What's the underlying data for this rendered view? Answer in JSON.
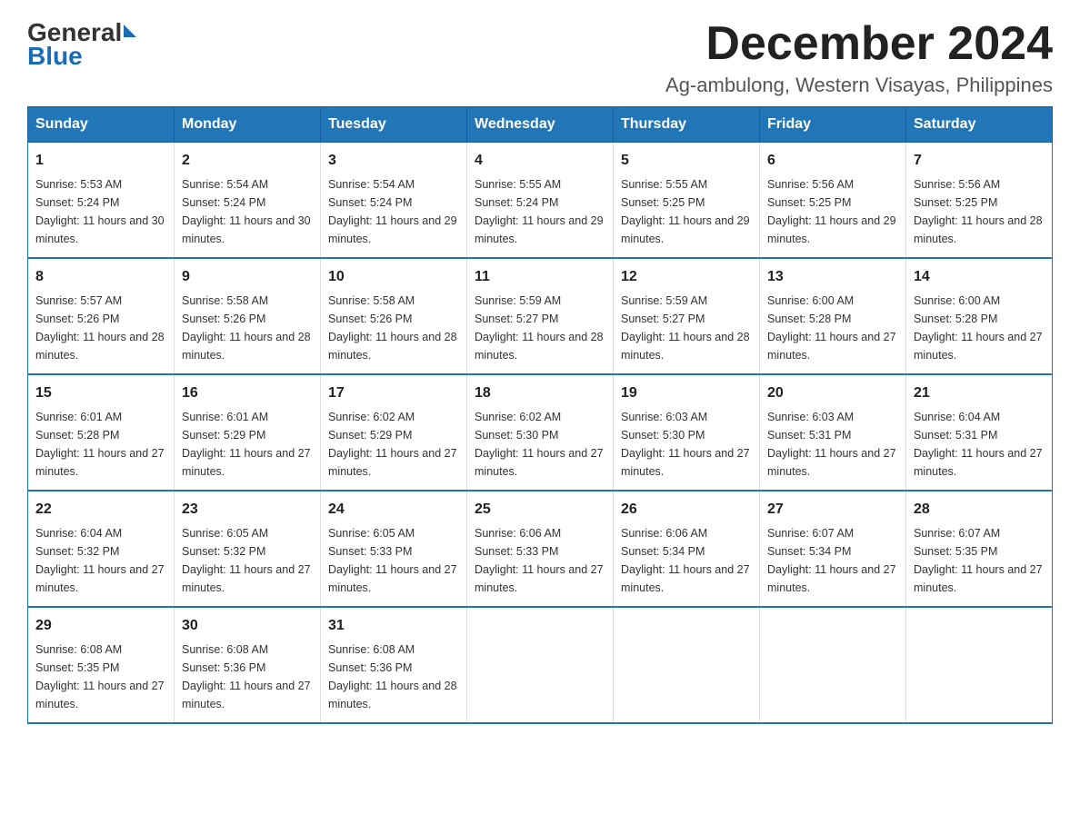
{
  "header": {
    "logo_general": "General",
    "logo_blue": "Blue",
    "month_title": "December 2024",
    "location": "Ag-ambulong, Western Visayas, Philippines"
  },
  "days_of_week": [
    "Sunday",
    "Monday",
    "Tuesday",
    "Wednesday",
    "Thursday",
    "Friday",
    "Saturday"
  ],
  "weeks": [
    [
      {
        "day": "1",
        "sunrise": "5:53 AM",
        "sunset": "5:24 PM",
        "daylight": "11 hours and 30 minutes."
      },
      {
        "day": "2",
        "sunrise": "5:54 AM",
        "sunset": "5:24 PM",
        "daylight": "11 hours and 30 minutes."
      },
      {
        "day": "3",
        "sunrise": "5:54 AM",
        "sunset": "5:24 PM",
        "daylight": "11 hours and 29 minutes."
      },
      {
        "day": "4",
        "sunrise": "5:55 AM",
        "sunset": "5:24 PM",
        "daylight": "11 hours and 29 minutes."
      },
      {
        "day": "5",
        "sunrise": "5:55 AM",
        "sunset": "5:25 PM",
        "daylight": "11 hours and 29 minutes."
      },
      {
        "day": "6",
        "sunrise": "5:56 AM",
        "sunset": "5:25 PM",
        "daylight": "11 hours and 29 minutes."
      },
      {
        "day": "7",
        "sunrise": "5:56 AM",
        "sunset": "5:25 PM",
        "daylight": "11 hours and 28 minutes."
      }
    ],
    [
      {
        "day": "8",
        "sunrise": "5:57 AM",
        "sunset": "5:26 PM",
        "daylight": "11 hours and 28 minutes."
      },
      {
        "day": "9",
        "sunrise": "5:58 AM",
        "sunset": "5:26 PM",
        "daylight": "11 hours and 28 minutes."
      },
      {
        "day": "10",
        "sunrise": "5:58 AM",
        "sunset": "5:26 PM",
        "daylight": "11 hours and 28 minutes."
      },
      {
        "day": "11",
        "sunrise": "5:59 AM",
        "sunset": "5:27 PM",
        "daylight": "11 hours and 28 minutes."
      },
      {
        "day": "12",
        "sunrise": "5:59 AM",
        "sunset": "5:27 PM",
        "daylight": "11 hours and 28 minutes."
      },
      {
        "day": "13",
        "sunrise": "6:00 AM",
        "sunset": "5:28 PM",
        "daylight": "11 hours and 27 minutes."
      },
      {
        "day": "14",
        "sunrise": "6:00 AM",
        "sunset": "5:28 PM",
        "daylight": "11 hours and 27 minutes."
      }
    ],
    [
      {
        "day": "15",
        "sunrise": "6:01 AM",
        "sunset": "5:28 PM",
        "daylight": "11 hours and 27 minutes."
      },
      {
        "day": "16",
        "sunrise": "6:01 AM",
        "sunset": "5:29 PM",
        "daylight": "11 hours and 27 minutes."
      },
      {
        "day": "17",
        "sunrise": "6:02 AM",
        "sunset": "5:29 PM",
        "daylight": "11 hours and 27 minutes."
      },
      {
        "day": "18",
        "sunrise": "6:02 AM",
        "sunset": "5:30 PM",
        "daylight": "11 hours and 27 minutes."
      },
      {
        "day": "19",
        "sunrise": "6:03 AM",
        "sunset": "5:30 PM",
        "daylight": "11 hours and 27 minutes."
      },
      {
        "day": "20",
        "sunrise": "6:03 AM",
        "sunset": "5:31 PM",
        "daylight": "11 hours and 27 minutes."
      },
      {
        "day": "21",
        "sunrise": "6:04 AM",
        "sunset": "5:31 PM",
        "daylight": "11 hours and 27 minutes."
      }
    ],
    [
      {
        "day": "22",
        "sunrise": "6:04 AM",
        "sunset": "5:32 PM",
        "daylight": "11 hours and 27 minutes."
      },
      {
        "day": "23",
        "sunrise": "6:05 AM",
        "sunset": "5:32 PM",
        "daylight": "11 hours and 27 minutes."
      },
      {
        "day": "24",
        "sunrise": "6:05 AM",
        "sunset": "5:33 PM",
        "daylight": "11 hours and 27 minutes."
      },
      {
        "day": "25",
        "sunrise": "6:06 AM",
        "sunset": "5:33 PM",
        "daylight": "11 hours and 27 minutes."
      },
      {
        "day": "26",
        "sunrise": "6:06 AM",
        "sunset": "5:34 PM",
        "daylight": "11 hours and 27 minutes."
      },
      {
        "day": "27",
        "sunrise": "6:07 AM",
        "sunset": "5:34 PM",
        "daylight": "11 hours and 27 minutes."
      },
      {
        "day": "28",
        "sunrise": "6:07 AM",
        "sunset": "5:35 PM",
        "daylight": "11 hours and 27 minutes."
      }
    ],
    [
      {
        "day": "29",
        "sunrise": "6:08 AM",
        "sunset": "5:35 PM",
        "daylight": "11 hours and 27 minutes."
      },
      {
        "day": "30",
        "sunrise": "6:08 AM",
        "sunset": "5:36 PM",
        "daylight": "11 hours and 27 minutes."
      },
      {
        "day": "31",
        "sunrise": "6:08 AM",
        "sunset": "5:36 PM",
        "daylight": "11 hours and 28 minutes."
      },
      null,
      null,
      null,
      null
    ]
  ]
}
